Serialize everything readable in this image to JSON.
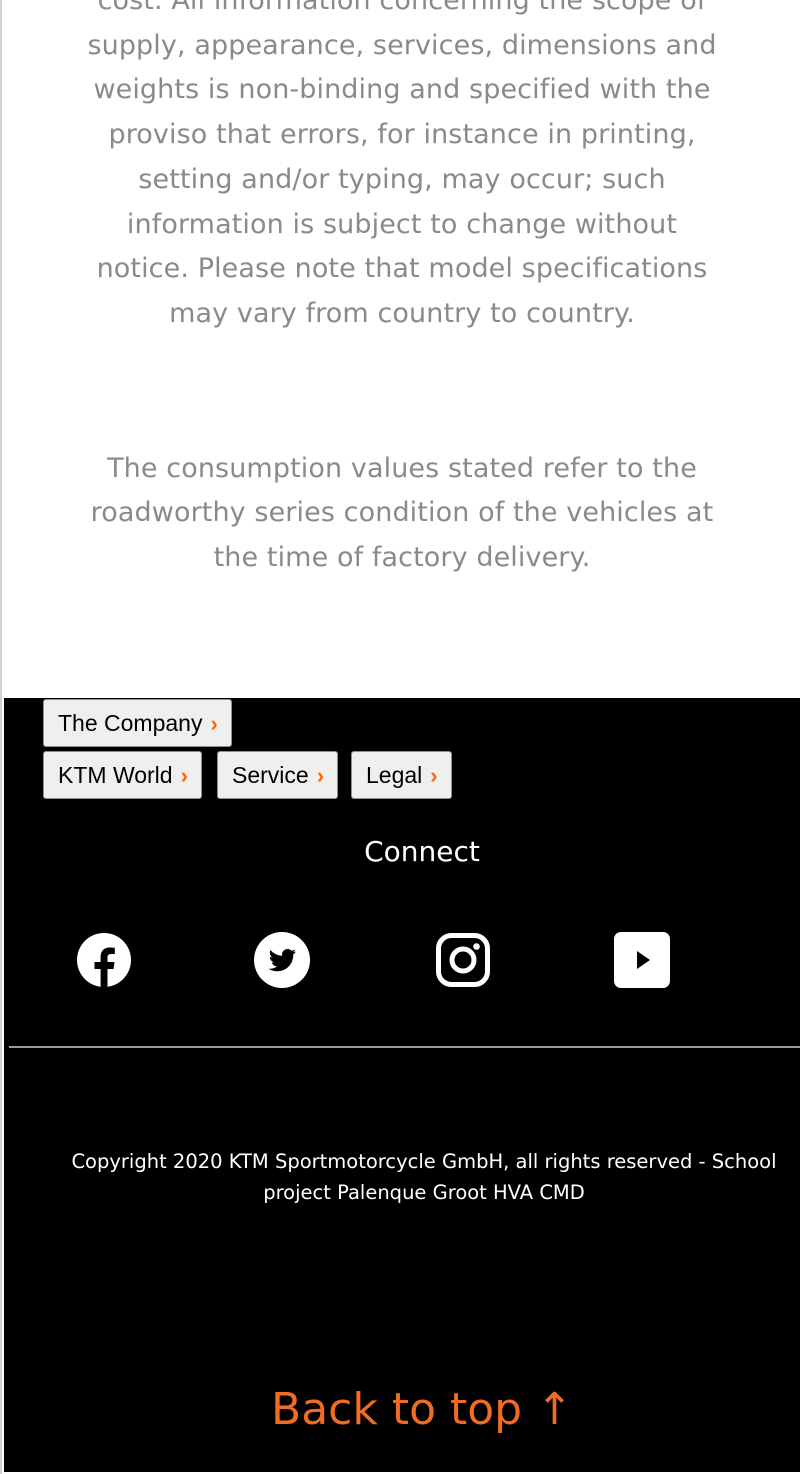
{
  "disclaimer": {
    "paragraph1": "cost. All information concerning the scope of supply, appearance, services, dimensions and weights is non-binding and specified with the proviso that errors, for instance in printing, setting and/or typing, may occur; such information is subject to change without notice. Please note that model specifications may vary from country to country.",
    "paragraph2": "The consumption values stated refer to the roadworthy series condition of the vehicles at the time of factory delivery."
  },
  "footer": {
    "menu": [
      {
        "label": "The Company"
      },
      {
        "label": "KTM World"
      },
      {
        "label": "Service"
      },
      {
        "label": "Legal"
      }
    ],
    "chevron": "›",
    "connect_title": "Connect",
    "social": [
      {
        "name": "facebook-icon"
      },
      {
        "name": "twitter-icon"
      },
      {
        "name": "instagram-icon"
      },
      {
        "name": "youtube-icon"
      }
    ],
    "copyright": "Copyright 2020 KTM Sportmotorcycle GmbH, all rights reserved - School project Palenque Groot HVA CMD",
    "back_to_top": "Back to top ↑"
  },
  "colors": {
    "accent": "#f26b23",
    "text_grey": "#8a8a8a",
    "footer_bg": "#000000"
  }
}
